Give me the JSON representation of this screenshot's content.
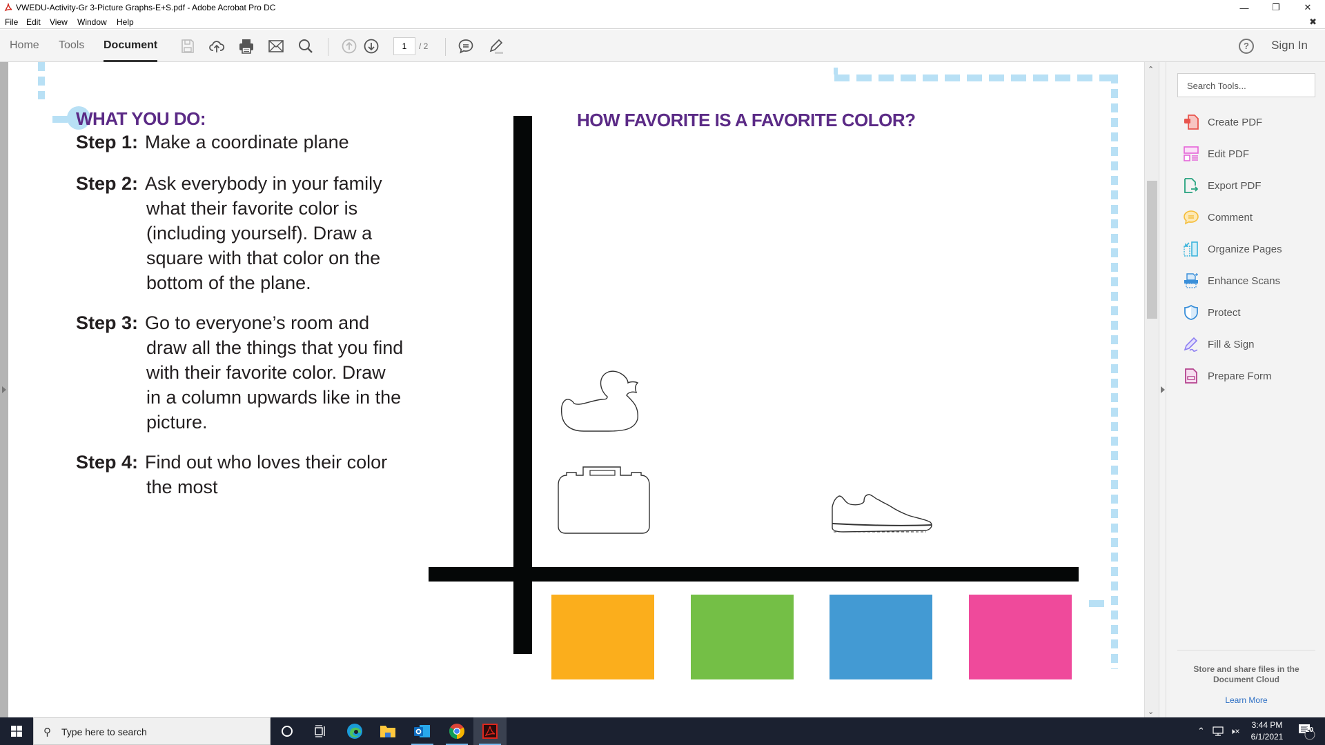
{
  "window": {
    "title": "VWEDU-Activity-Gr 3-Picture Graphs-E+S.pdf - Adobe Acrobat Pro DC",
    "controls": [
      "minimize",
      "restore",
      "close"
    ]
  },
  "menu": [
    "File",
    "Edit",
    "View",
    "Window",
    "Help"
  ],
  "toolbar": {
    "tabs": [
      {
        "label": "Home",
        "active": false
      },
      {
        "label": "Tools",
        "active": false
      },
      {
        "label": "Document",
        "active": true
      }
    ],
    "icons": [
      "save-icon",
      "upload-cloud-icon",
      "print-icon",
      "email-icon",
      "search-icon",
      "page-up-icon",
      "page-down-icon",
      "comment-icon",
      "highlight-pen-icon"
    ],
    "current_page": "1",
    "total_pages": "/ 2",
    "help_label": "?",
    "sign_in": "Sign In"
  },
  "document": {
    "what_you_do": "WHAT YOU DO:",
    "steps": [
      {
        "label": "Step 1:",
        "lines": [
          "Make a coordinate plane"
        ]
      },
      {
        "label": "Step 2:",
        "lines": [
          "Ask everybody in your family",
          "what their favorite color is",
          "(including yourself). Draw a",
          "square with that color on the",
          "bottom of the plane."
        ]
      },
      {
        "label": "Step 3:",
        "lines": [
          "Go to everyone’s room and",
          "draw all the things that you find",
          "with their favorite color. Draw",
          "in a column upwards like in the",
          "picture."
        ]
      },
      {
        "label": "Step 4:",
        "lines": [
          "Find out who loves their color",
          "the most"
        ]
      }
    ],
    "chart_title": "HOW FAVORITE IS A FAVORITE COLOR?",
    "colors": {
      "title_purple": "#5b2a86",
      "dash_blue": "#b8e0f5",
      "axis": "#050707"
    }
  },
  "chart_data": {
    "type": "bar",
    "title": "HOW FAVORITE IS A FAVORITE COLOR?",
    "xlabel": "",
    "ylabel": "",
    "categories": [
      "orange",
      "green",
      "blue",
      "pink"
    ],
    "category_colors": [
      "#fbae1c",
      "#74bf46",
      "#439ad3",
      "#ef4a9b"
    ],
    "values": [
      2,
      0,
      1,
      0
    ],
    "pictures": [
      {
        "category": "orange",
        "items": [
          "briefcase",
          "rubber duck"
        ]
      },
      {
        "category": "green",
        "items": []
      },
      {
        "category": "blue",
        "items": [
          "sneaker"
        ]
      },
      {
        "category": "pink",
        "items": []
      }
    ]
  },
  "right_panel": {
    "search_placeholder": "Search Tools...",
    "tools": [
      {
        "label": "Create PDF",
        "icon": "create-pdf-icon",
        "color": "#e8554e"
      },
      {
        "label": "Edit PDF",
        "icon": "edit-pdf-icon",
        "color": "#e563d8"
      },
      {
        "label": "Export PDF",
        "icon": "export-pdf-icon",
        "color": "#26a37f"
      },
      {
        "label": "Comment",
        "icon": "comment-icon",
        "color": "#f5bd3a"
      },
      {
        "label": "Organize Pages",
        "icon": "organize-pages-icon",
        "color": "#3bb4dc"
      },
      {
        "label": "Enhance Scans",
        "icon": "enhance-scans-icon",
        "color": "#3a8fd9"
      },
      {
        "label": "Protect",
        "icon": "protect-icon",
        "color": "#3a8fd9"
      },
      {
        "label": "Fill & Sign",
        "icon": "fill-sign-icon",
        "color": "#8d7ef2"
      },
      {
        "label": "Prepare Form",
        "icon": "prepare-form-icon",
        "color": "#b5438e"
      }
    ],
    "cloud_text": "Store and share files in the Document Cloud",
    "learn_more": "Learn More"
  },
  "taskbar": {
    "search_placeholder": "Type here to search",
    "apps": [
      "cortana",
      "task-view",
      "edge",
      "file-explorer",
      "outlook",
      "chrome",
      "acrobat"
    ],
    "time": "3:44 PM",
    "date": "6/1/2021",
    "notification_count": "20"
  }
}
